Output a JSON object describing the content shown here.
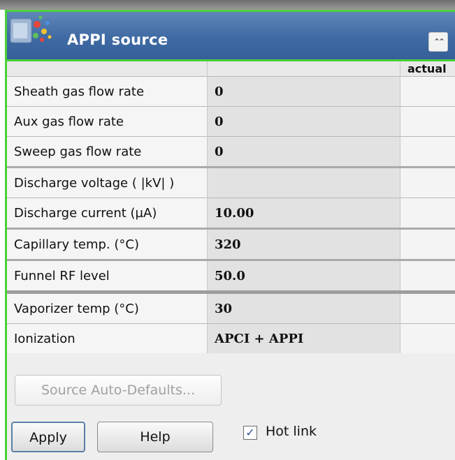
{
  "panel": {
    "title": "APPI source",
    "collapse_glyph": "⌃⌃",
    "logo_icon": "source-spray-icon",
    "accent_color": "#4ad03a",
    "title_bar_color": "#3f6aa3"
  },
  "table": {
    "header_actual": "actual",
    "rows": [
      {
        "label": "Sheath gas flow rate",
        "value": "0"
      },
      {
        "label": "Aux gas flow rate",
        "value": "0"
      },
      {
        "label": "Sweep gas flow rate",
        "value": "0"
      },
      {
        "label": "Discharge voltage ( |kV| )",
        "value": ""
      },
      {
        "label": "Discharge current (µA)",
        "value": "10.00"
      },
      {
        "label": "Capillary temp. (°C)",
        "value": "320"
      },
      {
        "label": "Funnel RF level",
        "value": "50.0"
      },
      {
        "label": "Vaporizer temp (°C)",
        "value": "30"
      },
      {
        "label": "Ionization",
        "value": "APCI + APPI"
      }
    ]
  },
  "buttons": {
    "auto_defaults": "Source Auto-Defaults...",
    "apply": "Apply",
    "help": "Help"
  },
  "hot_link": {
    "label": "Hot link",
    "checked": true,
    "check_glyph": "✓"
  }
}
